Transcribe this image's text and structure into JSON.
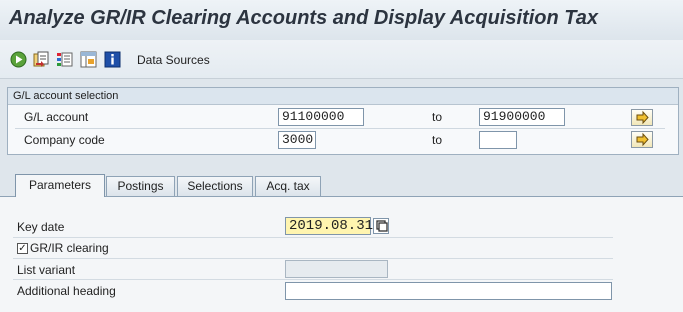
{
  "title": "Analyze GR/IR Clearing Accounts and Display Acquisition Tax",
  "toolbar": {
    "icons": [
      "execute-icon",
      "copy-variant-icon",
      "selection-options-icon",
      "dynamic-selections-icon",
      "info-icon"
    ],
    "data_sources_label": "Data Sources"
  },
  "gl_selection": {
    "header": "G/L account selection",
    "rows": [
      {
        "label": "G/L account",
        "from": "91100000",
        "to_label": "to",
        "to": "91900000"
      },
      {
        "label": "Company code",
        "from": "3000",
        "to_label": "to",
        "to": ""
      }
    ]
  },
  "tabs": [
    {
      "label": "Parameters",
      "active": true
    },
    {
      "label": "Postings",
      "active": false
    },
    {
      "label": "Selections",
      "active": false
    },
    {
      "label": "Acq. tax",
      "active": false
    }
  ],
  "parameters": {
    "key_date_label": "Key date",
    "key_date_value": "2019.08.31",
    "grir_label": "GR/IR clearing",
    "grir_checked": true,
    "list_variant_label": "List variant",
    "list_variant_value": "",
    "additional_heading_label": "Additional heading",
    "additional_heading_value": ""
  }
}
